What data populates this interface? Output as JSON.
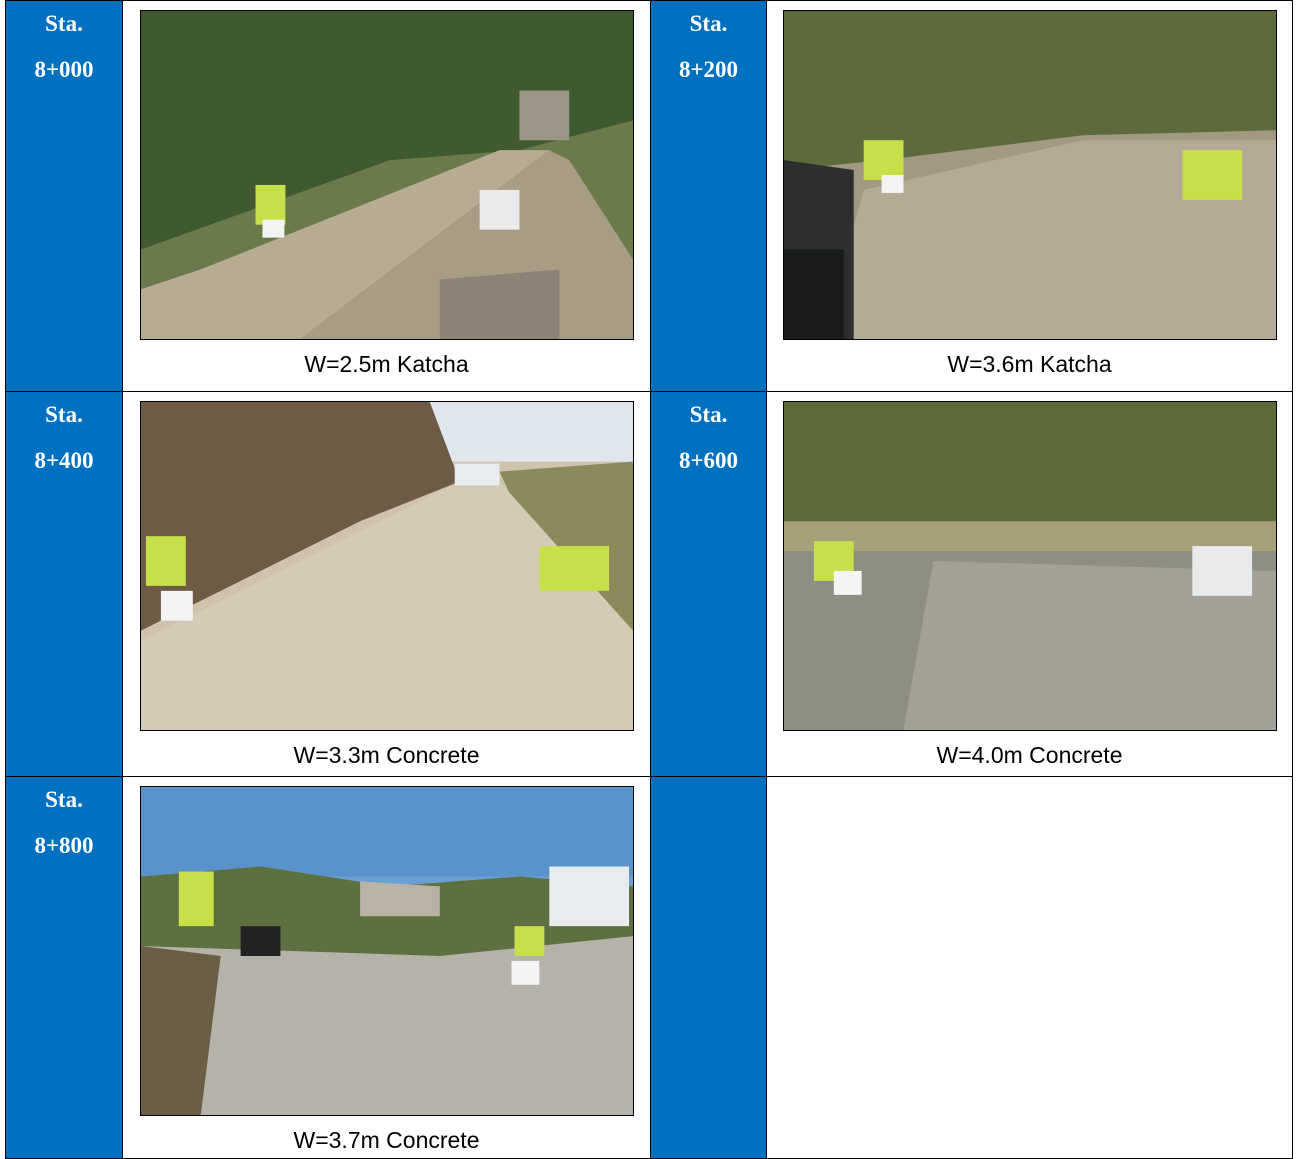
{
  "rows": [
    {
      "left": {
        "label": "Sta.",
        "station": "8+000",
        "caption": "W=2.5m Katcha",
        "photo": "road-photo-katcha-valley"
      },
      "right": {
        "label": "Sta.",
        "station": "8+200",
        "caption": "W=3.6m Katcha",
        "photo": "road-photo-katcha-vehicle"
      }
    },
    {
      "left": {
        "label": "Sta.",
        "station": "8+400",
        "caption": "W=3.3m Concrete",
        "photo": "road-photo-concrete-car"
      },
      "right": {
        "label": "Sta.",
        "station": "8+600",
        "caption": "W=4.0m Concrete",
        "photo": "road-photo-concrete-hillside"
      }
    },
    {
      "left": {
        "label": "Sta.",
        "station": "8+800",
        "caption": "W=3.7m Concrete",
        "photo": "road-photo-concrete-town-view"
      }
    }
  ],
  "colors": {
    "station_cell": "#0070c0",
    "station_text": "#ffffff",
    "border": "#000000"
  }
}
